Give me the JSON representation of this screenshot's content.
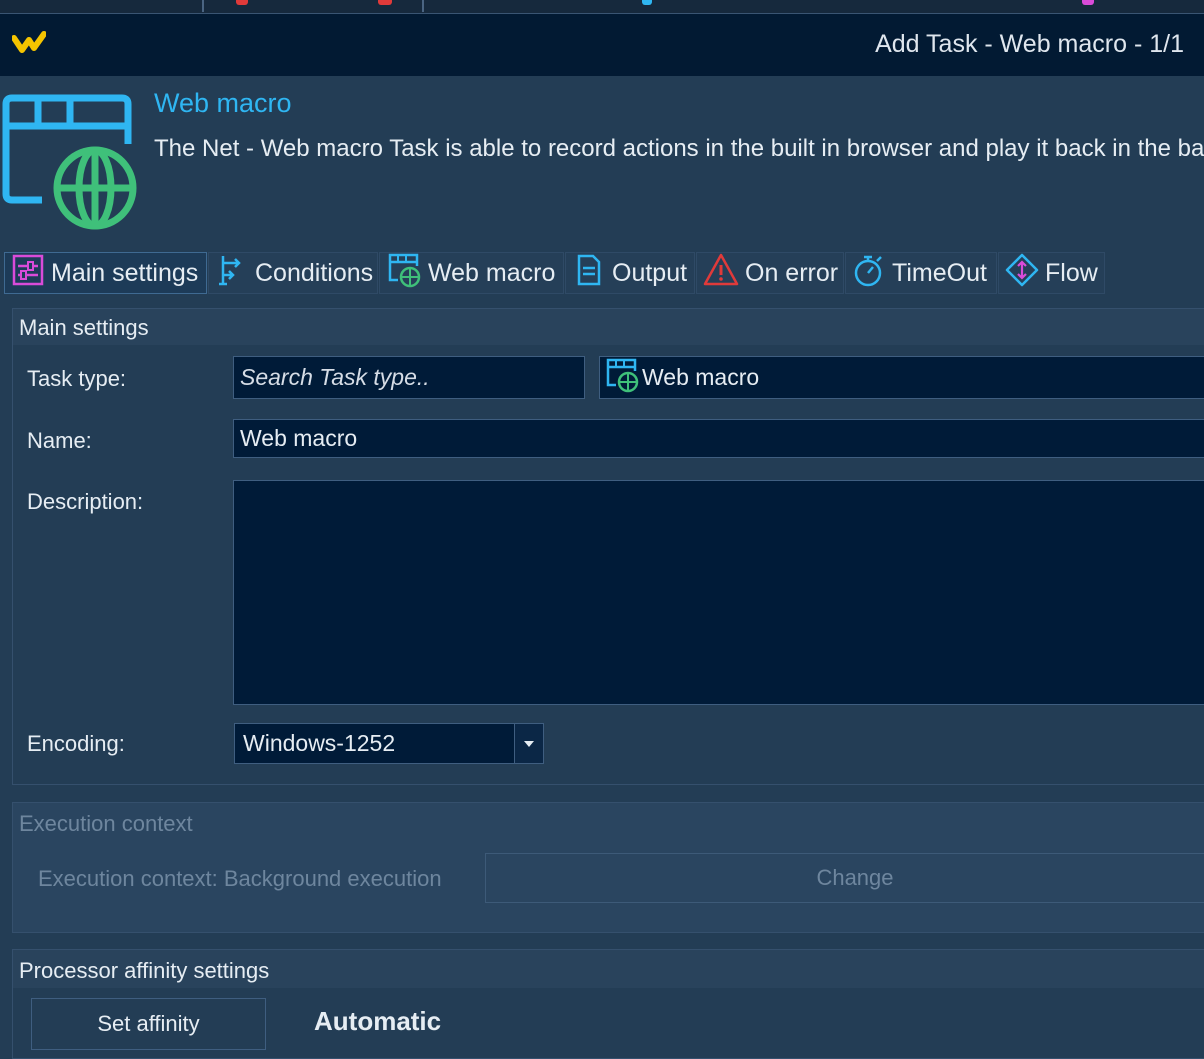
{
  "window": {
    "title": "Add Task - Web macro - 1/1"
  },
  "header": {
    "title": "Web macro",
    "description": "The Net - Web macro Task is able to record actions in the built in browser and play it back in the backg"
  },
  "tabs": [
    {
      "label": "Main settings",
      "icon": "sliders-icon",
      "active": true
    },
    {
      "label": "Conditions",
      "icon": "conditions-icon"
    },
    {
      "label": "Web macro",
      "icon": "web-macro-icon"
    },
    {
      "label": "Output",
      "icon": "document-icon"
    },
    {
      "label": "On error",
      "icon": "warning-icon"
    },
    {
      "label": "TimeOut",
      "icon": "stopwatch-icon"
    },
    {
      "label": "Flow",
      "icon": "flow-icon"
    }
  ],
  "main_settings": {
    "title": "Main settings",
    "task_type_label": "Task type:",
    "task_type_placeholder": "Search Task type..",
    "task_type_value": "Web macro",
    "name_label": "Name:",
    "name_value": "Web macro",
    "description_label": "Description:",
    "description_value": "",
    "encoding_label": "Encoding:",
    "encoding_value": "Windows-1252"
  },
  "execution_context": {
    "title": "Execution context",
    "text": "Execution context: Background execution",
    "change_label": "Change"
  },
  "processor_affinity": {
    "title": "Processor affinity settings",
    "set_affinity_label": "Set affinity",
    "value": "Automatic"
  },
  "colors": {
    "background": "#233d55",
    "titlebar": "#021a33",
    "input": "#001b38",
    "accent": "#2fb6f2",
    "icon_green": "#3fc07a",
    "icon_red": "#e03a3a",
    "icon_magenta": "#d94bd9"
  }
}
